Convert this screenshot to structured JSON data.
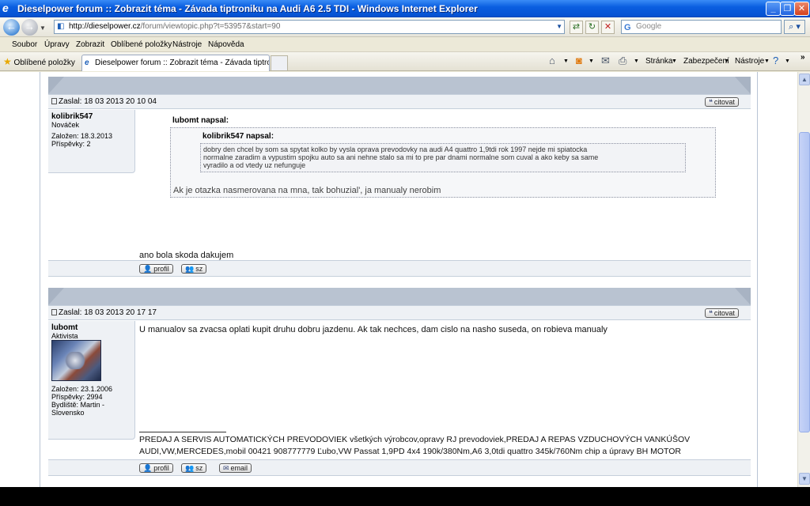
{
  "window": {
    "title": "Dieselpower forum :: Zobrazit téma - Závada tiptroniku na Audi A6 2.5 TDI - Windows Internet Explorer"
  },
  "address": {
    "host": "http://dieselpower.cz",
    "path": "/forum/viewtopic.php?t=53957&start=90"
  },
  "search": {
    "placeholder": "Google"
  },
  "menu": [
    "Soubor",
    "Úpravy",
    "Zobrazit",
    "Oblíbené položky",
    "Nástroje",
    "Nápověda"
  ],
  "favorites_label": "Oblíbené položky",
  "tab_title": "Dieselpower forum :: Zobrazit téma - Závada tiptronik...",
  "commands": {
    "page": "Stránka",
    "security": "Zabezpečení",
    "tools": "Nástroje"
  },
  "posts": [
    {
      "posted": "Zaslal: 18 03 2013 20 10 04",
      "quote_button": "citovat",
      "author": "kolibrik547",
      "rank": "Nováček",
      "joined": "Založen: 18.3.2013",
      "posts_count": "Příspěvky: 2",
      "outer_quote_title": "lubomt napsal:",
      "inner_quote_title": "kolibrik547 napsal:",
      "inner_quote_lines": [
        "dobry den chcel by som sa spytat kolko by vysla oprava prevodovky na audi A4 quattro 1,9tdi rok 1997 nejde mi spiatocka",
        "normalne zaradim a vypustim spojku auto sa ani nehne stalo sa mi to pre par dnami normalne som cuval a ako keby sa same",
        "vyradilo a od vtedy uz nefunguje"
      ],
      "outer_quote_text": "Ak je otazka nasmerovana na mna, tak bohuzial', ja manualy nerobim",
      "message": "ano bola skoda dakujem",
      "footer_buttons": {
        "profile": "profil",
        "pm": "sz"
      }
    },
    {
      "posted": "Zaslal: 18 03 2013 20 17 17",
      "quote_button": "citovat",
      "author": "lubomt",
      "rank": "Aktivista",
      "joined": "Založen: 23.1.2006",
      "posts_count": "Příspěvky: 2994",
      "location_lines": [
        "Bydliště: Martin -",
        "Slovensko"
      ],
      "message": "U manualov sa zvacsa oplati kupit druhu dobru jazdenu. Ak tak nechces, dam cislo na nasho suseda, on robieva manualy",
      "signature_lines": [
        "PREDAJ A SERVIS AUTOMATICKÝCH PREVODOVIEK všetkých výrobcov,opravy RJ prevodoviek,PREDAJ A REPAS VZDUCHOVÝCH VANKÚŠOV",
        "AUDI,VW,MERCEDES,mobil 00421 908777779 Ľubo,VW Passat 1,9PD 4x4 190k/380Nm,A6 3,0tdi quattro 345k/760Nm chip a úpravy BH MOTOR"
      ],
      "footer_buttons": {
        "profile": "profil",
        "pm": "sz",
        "email": "email"
      }
    }
  ],
  "colors": {
    "titlebar": "#0653d3",
    "header_band": "#a8b3c3",
    "row_bg": "#eef1f5"
  }
}
